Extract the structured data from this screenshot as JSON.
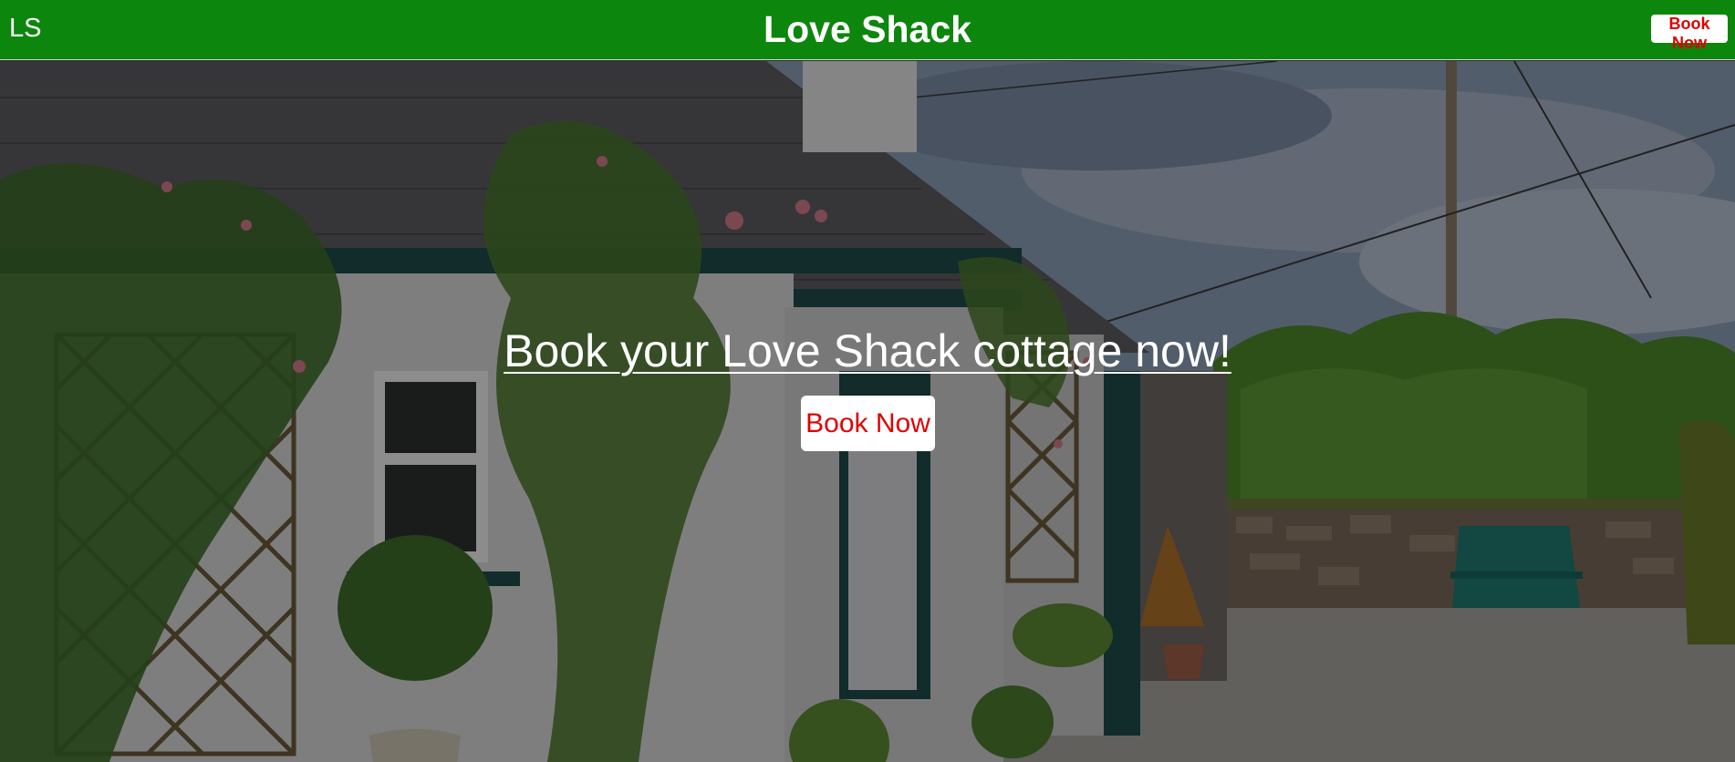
{
  "header": {
    "logo_text": "LS",
    "title": "Love Shack",
    "book_button_label": "Book Now"
  },
  "hero": {
    "heading": "Book your Love Shack cottage now!",
    "book_button_label": "Book Now",
    "image_description": "cottage-exterior-photo"
  },
  "colors": {
    "header_background": "#0d860d",
    "button_background": "#ffffff",
    "button_text": "#e00000",
    "heading_text": "#ffffff"
  }
}
